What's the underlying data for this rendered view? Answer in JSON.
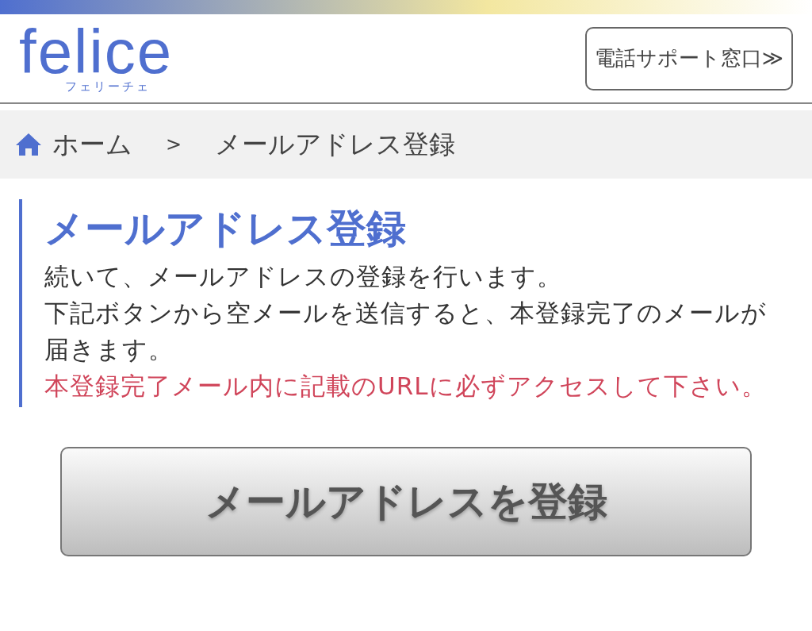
{
  "header": {
    "logo": "felice",
    "logo_sub": "フェリーチェ",
    "support_button": "電話サポート窓口≫"
  },
  "breadcrumb": {
    "home": "ホーム",
    "separator": ">",
    "current": "メールアドレス登録"
  },
  "section": {
    "title": "メールアドレス登録",
    "paragraphs": [
      {
        "kind": "normal",
        "text": "続いて、メールアドレスの登録を行います。"
      },
      {
        "kind": "normal",
        "text": "下記ボタンから空メールを送信すると、本登録完了のメールが届きます。"
      },
      {
        "kind": "notice",
        "text": "本登録完了メール内に記載のURLに必ずアクセスして下さい。"
      }
    ]
  },
  "register_button": "メールアドレスを登録"
}
